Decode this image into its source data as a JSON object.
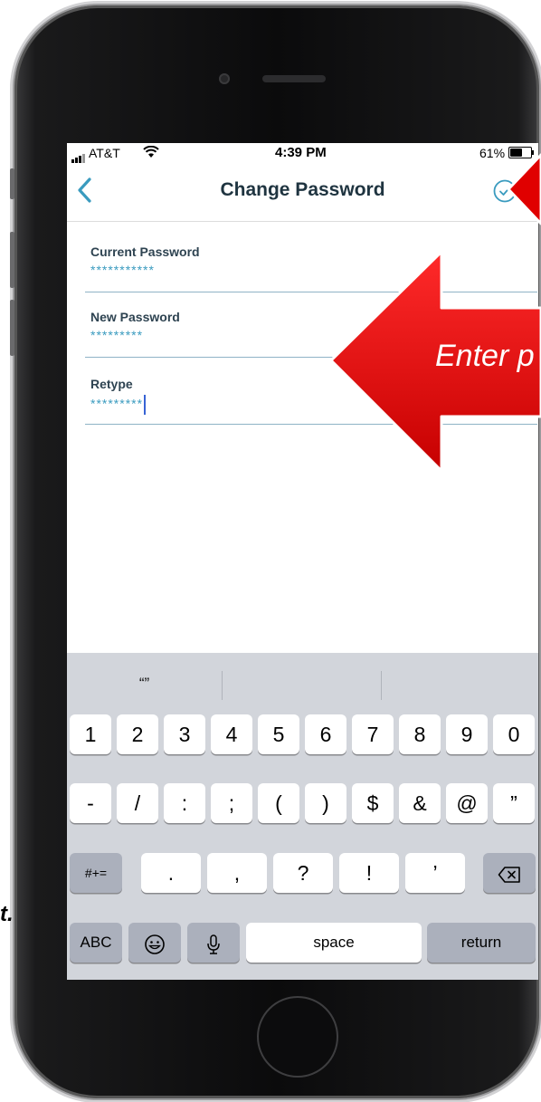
{
  "status": {
    "carrier": "AT&T",
    "time": "4:39 PM",
    "battery_pct": "61%",
    "battery_level": 0.61
  },
  "nav": {
    "title": "Change Password"
  },
  "fields": [
    {
      "label": "Current Password",
      "value": "***********"
    },
    {
      "label": "New Password",
      "value": "*********"
    },
    {
      "label": "Retype",
      "value": "*********"
    }
  ],
  "keyboard": {
    "suggestion": "“”",
    "row1": [
      "1",
      "2",
      "3",
      "4",
      "5",
      "6",
      "7",
      "8",
      "9",
      "0"
    ],
    "row2": [
      "-",
      "/",
      ":",
      ";",
      "(",
      ")",
      "$",
      "&",
      "@",
      "”"
    ],
    "row3": [
      ".",
      ",",
      "?",
      "!",
      "’"
    ],
    "shift_label": "#+=",
    "abc_label": "ABC",
    "space_label": "space",
    "return_label": "return"
  },
  "annotation": {
    "arrow_text": "Enter p",
    "side_fragment": "t.",
    "arrow_color": "#e00000"
  },
  "colors": {
    "accent": "#3a9bbf",
    "title": "#1f3440",
    "keyboard_bg": "#d2d5db"
  }
}
